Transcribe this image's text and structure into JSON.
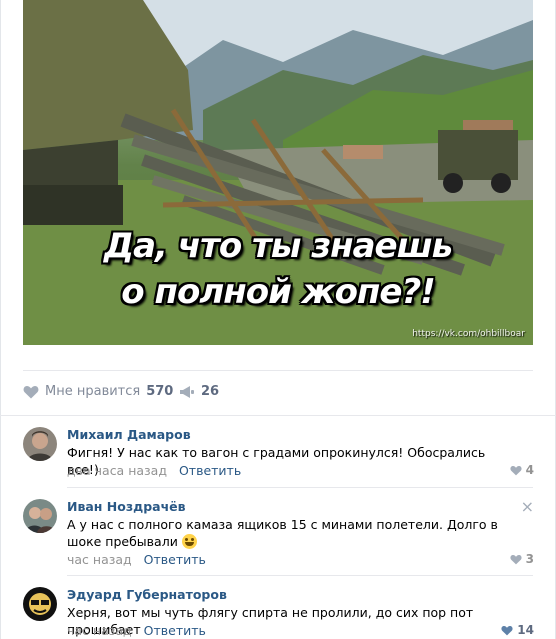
{
  "post": {
    "image": {
      "caption_line1": "Да, что ты знаешь",
      "caption_line2": "о полной жопе?!",
      "watermark": "https://vk.com/ohbillboar"
    },
    "actions": {
      "like_label": "Мне нравится",
      "like_count": "570",
      "share_count": "26"
    }
  },
  "comments": [
    {
      "author": "Михаил Дамаров",
      "text": "Фигня! У нас как то вагон с градами опрокинулся! Обосрались все!)",
      "time": "два часа назад",
      "reply": "Ответить",
      "likes": "4"
    },
    {
      "author": "Иван Ноздрачёв",
      "text": "А у нас с полного камаза ящиков 15 с минами полетели. Долго в шоке пребывали",
      "time": "час назад",
      "reply": "Ответить",
      "likes": "3",
      "close_icon": "×"
    },
    {
      "author": "Эдуард Губернаторов",
      "text": "Херня, вот мы чуть флягу спирта не пролили, до сих пор пот прошибает",
      "time": "час назад",
      "reply": "Ответить",
      "likes": "14"
    }
  ],
  "colors": {
    "link": "#2a5885",
    "muted": "#939393",
    "icon": "#a4adb9",
    "divider": "#e7e8ec"
  }
}
